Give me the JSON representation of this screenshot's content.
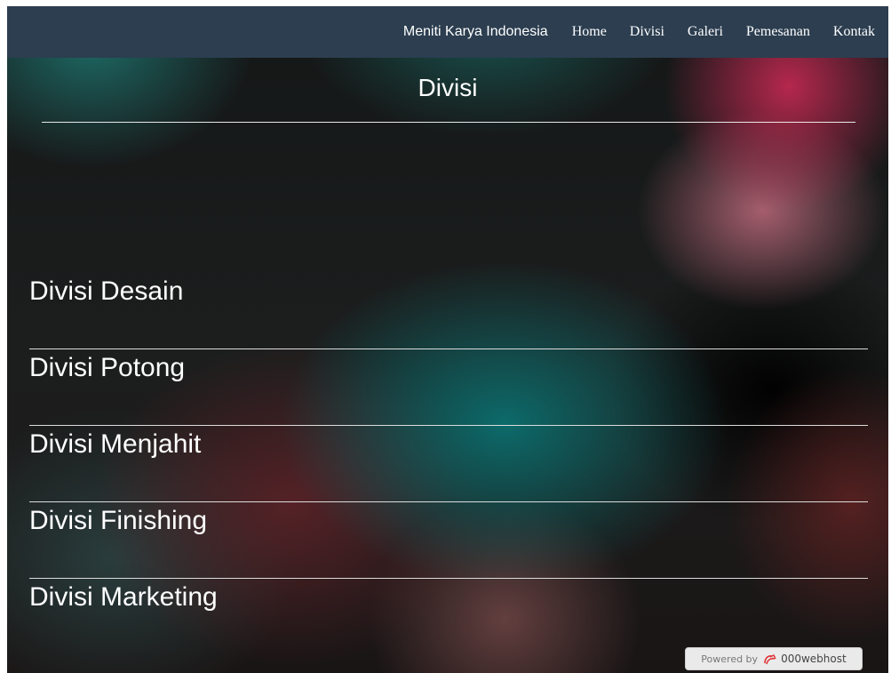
{
  "navbar": {
    "brand": "Meniti Karya Indonesia",
    "links": [
      "Home",
      "Divisi",
      "Galeri",
      "Pemesanan",
      "Kontak"
    ],
    "background_color": "#2c3e50"
  },
  "page": {
    "title": "Divisi"
  },
  "divisions": [
    {
      "label": "Divisi Desain"
    },
    {
      "label": "Divisi Potong"
    },
    {
      "label": "Divisi Menjahit"
    },
    {
      "label": "Divisi Finishing"
    },
    {
      "label": "Divisi Marketing"
    }
  ],
  "footer_badge": {
    "powered_by": "Powered by",
    "host_icon": "000webhost-logo-icon",
    "host_name": "000webhost",
    "accent_color": "#e0363a"
  }
}
